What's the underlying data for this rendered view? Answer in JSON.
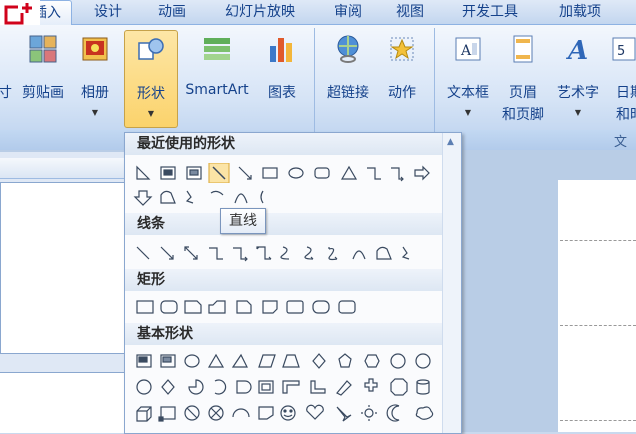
{
  "tabs": [
    {
      "label": "插入",
      "active": true
    },
    {
      "label": "设计"
    },
    {
      "label": "动画"
    },
    {
      "label": "幻灯片放映"
    },
    {
      "label": "审阅"
    },
    {
      "label": "视图"
    },
    {
      "label": "开发工具"
    },
    {
      "label": "加载项"
    }
  ],
  "ribbon": {
    "buttons": [
      {
        "label": "剪贴画"
      },
      {
        "label": "相册"
      },
      {
        "label": "形状"
      },
      {
        "label": "SmartArt"
      },
      {
        "label": "图表"
      },
      {
        "label": "超链接"
      },
      {
        "label": "动作"
      },
      {
        "label": "文本框"
      },
      {
        "label": "页眉",
        "label2": "和页脚"
      },
      {
        "label": "艺术字"
      },
      {
        "label": "日期",
        "label2": "和时"
      }
    ],
    "group_caption_right": "文"
  },
  "gallery": {
    "sections": [
      {
        "title": "最近使用的形状"
      },
      {
        "title": "线条"
      },
      {
        "title": "矩形"
      },
      {
        "title": "基本形状"
      }
    ],
    "tooltip": "直线"
  },
  "colors": {
    "ribbon_bg": "#d6e4f6",
    "accent_highlight": "#fbe4a6",
    "text": "#15428b"
  }
}
